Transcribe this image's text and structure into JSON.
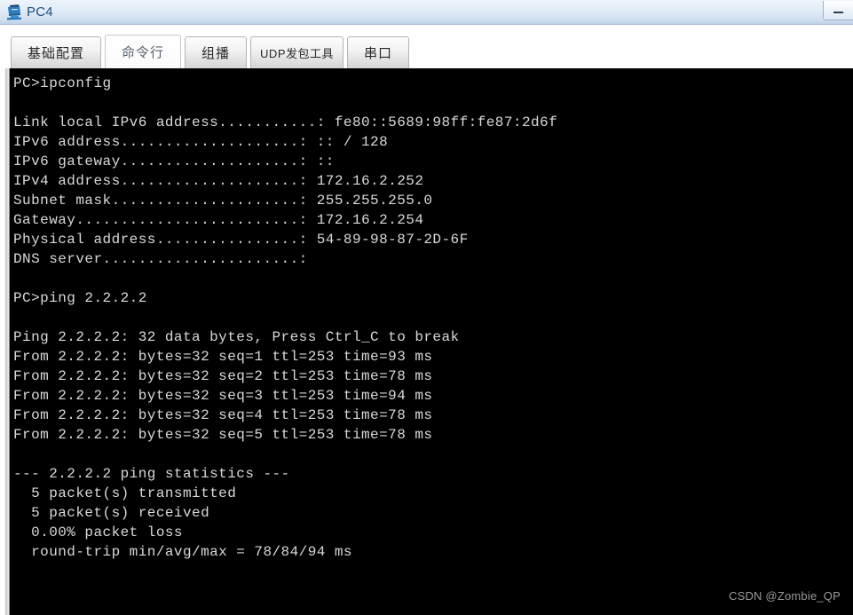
{
  "window": {
    "title": "PC4",
    "icon": "pc-monitor-icon",
    "minimize_label": "–",
    "titlebar_color": "#cfdeef",
    "title_text_color": "#1f4e79"
  },
  "tabs": [
    {
      "label": "基础配置",
      "name": "tab-basic-config",
      "active": false,
      "small": false
    },
    {
      "label": "命令行",
      "name": "tab-command-line",
      "active": true,
      "small": false
    },
    {
      "label": "组播",
      "name": "tab-multicast",
      "active": false,
      "small": false
    },
    {
      "label": "UDP发包工具",
      "name": "tab-udp-tool",
      "active": false,
      "small": true
    },
    {
      "label": "串口",
      "name": "tab-serial-port",
      "active": false,
      "small": false
    }
  ],
  "console": {
    "background": "#000000",
    "foreground": "#d9d9d9",
    "lines": [
      "PC>ipconfig",
      "",
      "Link local IPv6 address...........: fe80::5689:98ff:fe87:2d6f",
      "IPv6 address....................: :: / 128",
      "IPv6 gateway....................: ::",
      "IPv4 address....................: 172.16.2.252",
      "Subnet mask.....................: 255.255.255.0",
      "Gateway.........................: 172.16.2.254",
      "Physical address................: 54-89-98-87-2D-6F",
      "DNS server......................:",
      "",
      "PC>ping 2.2.2.2",
      "",
      "Ping 2.2.2.2: 32 data bytes, Press Ctrl_C to break",
      "From 2.2.2.2: bytes=32 seq=1 ttl=253 time=93 ms",
      "From 2.2.2.2: bytes=32 seq=2 ttl=253 time=78 ms",
      "From 2.2.2.2: bytes=32 seq=3 ttl=253 time=94 ms",
      "From 2.2.2.2: bytes=32 seq=4 ttl=253 time=78 ms",
      "From 2.2.2.2: bytes=32 seq=5 ttl=253 time=78 ms",
      "",
      "--- 2.2.2.2 ping statistics ---",
      "  5 packet(s) transmitted",
      "  5 packet(s) received",
      "  0.00% packet loss",
      "  round-trip min/avg/max = 78/84/94 ms"
    ],
    "ipconfig": {
      "command": "ipconfig",
      "prompt": "PC>",
      "fields": [
        {
          "label": "Link local IPv6 address",
          "value": "fe80::5689:98ff:fe87:2d6f"
        },
        {
          "label": "IPv6 address",
          "value": ":: / 128"
        },
        {
          "label": "IPv6 gateway",
          "value": "::"
        },
        {
          "label": "IPv4 address",
          "value": "172.16.2.252"
        },
        {
          "label": "Subnet mask",
          "value": "255.255.255.0"
        },
        {
          "label": "Gateway",
          "value": "172.16.2.254"
        },
        {
          "label": "Physical address",
          "value": "54-89-98-87-2D-6F"
        },
        {
          "label": "DNS server",
          "value": ""
        }
      ]
    },
    "ping": {
      "command": "ping 2.2.2.2",
      "target": "2.2.2.2",
      "header": "Ping 2.2.2.2: 32 data bytes, Press Ctrl_C to break",
      "data_bytes": 32,
      "replies": [
        {
          "from": "2.2.2.2",
          "bytes": 32,
          "seq": 1,
          "ttl": 253,
          "time_ms": 93
        },
        {
          "from": "2.2.2.2",
          "bytes": 32,
          "seq": 2,
          "ttl": 253,
          "time_ms": 78
        },
        {
          "from": "2.2.2.2",
          "bytes": 32,
          "seq": 3,
          "ttl": 253,
          "time_ms": 94
        },
        {
          "from": "2.2.2.2",
          "bytes": 32,
          "seq": 4,
          "ttl": 253,
          "time_ms": 78
        },
        {
          "from": "2.2.2.2",
          "bytes": 32,
          "seq": 5,
          "ttl": 253,
          "time_ms": 78
        }
      ],
      "statistics": {
        "header": "--- 2.2.2.2 ping statistics ---",
        "transmitted": "  5 packet(s) transmitted",
        "received": "  5 packet(s) received",
        "loss": "  0.00% packet loss",
        "round_trip": "  round-trip min/avg/max = 78/84/94 ms"
      }
    }
  },
  "watermark": "CSDN @Zombie_QP"
}
